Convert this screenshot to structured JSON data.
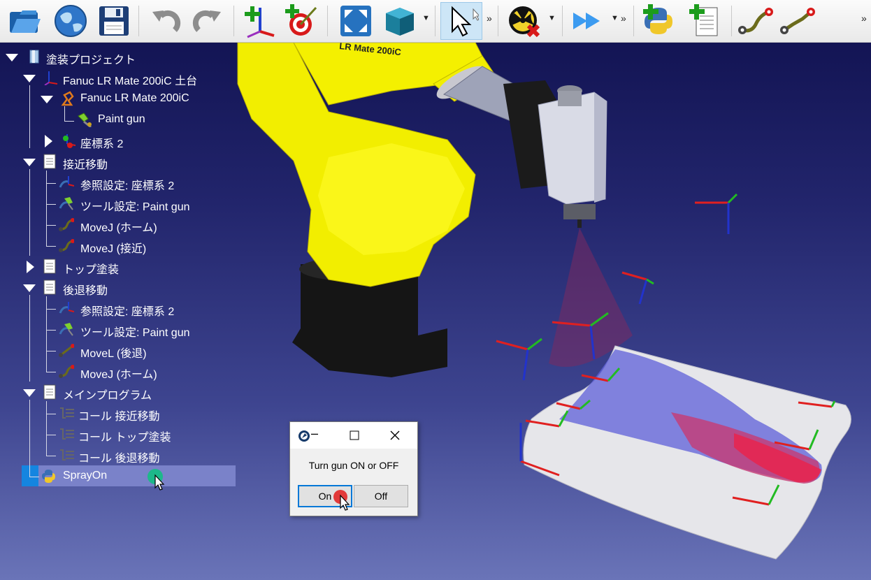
{
  "toolbar": {
    "buttons": [
      {
        "name": "open-folder-icon"
      },
      {
        "name": "online-library-icon"
      },
      {
        "name": "save-icon"
      },
      {
        "name": "undo-icon"
      },
      {
        "name": "redo-icon"
      },
      {
        "name": "add-reference-frame-icon"
      },
      {
        "name": "add-target-icon"
      },
      {
        "name": "fit-all-icon"
      },
      {
        "name": "view-cube-icon"
      },
      {
        "name": "select-pointer-icon"
      },
      {
        "name": "collision-detection-icon"
      },
      {
        "name": "fast-simulation-icon"
      },
      {
        "name": "add-python-script-icon"
      },
      {
        "name": "add-program-icon"
      },
      {
        "name": "move-joint-icon"
      },
      {
        "name": "move-linear-icon"
      }
    ],
    "more_glyph": "»",
    "dropdown_glyph": "▼"
  },
  "scene": {
    "robot_label": "LR Mate 200iC"
  },
  "tree": {
    "items": [
      {
        "label": "塗装プロジェクト"
      },
      {
        "label": "Fanuc LR Mate 200iC 土台"
      },
      {
        "label": "Fanuc LR Mate 200iC"
      },
      {
        "label": "Paint gun"
      },
      {
        "label": "座標系 2"
      },
      {
        "label": "接近移動"
      },
      {
        "label": "参照設定: 座標系 2"
      },
      {
        "label": "ツール設定: Paint gun"
      },
      {
        "label": "MoveJ (ホーム)"
      },
      {
        "label": "MoveJ (接近)"
      },
      {
        "label": "トップ塗装"
      },
      {
        "label": "後退移動"
      },
      {
        "label": "参照設定: 座標系 2"
      },
      {
        "label": "ツール設定: Paint gun"
      },
      {
        "label": "MoveL (後退)"
      },
      {
        "label": "MoveJ (ホーム)"
      },
      {
        "label": "メインプログラム"
      },
      {
        "label": "コール 接近移動"
      },
      {
        "label": "コール トップ塗装"
      },
      {
        "label": "コール 後退移動"
      },
      {
        "label": "SprayOn"
      }
    ]
  },
  "dialog": {
    "message": "Turn gun ON or OFF",
    "on_label": "On",
    "off_label": "Off"
  }
}
